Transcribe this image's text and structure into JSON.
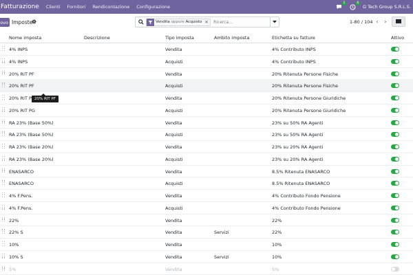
{
  "nav": {
    "brand": "Fatturazione",
    "menus": [
      "Clienti",
      "Fornitori",
      "Rendicontazione",
      "Configurazione"
    ],
    "chat_badge": "1",
    "activity_badge": "6",
    "company": "G Tech Group S.R.L.S."
  },
  "control": {
    "new_label": "ovo",
    "breadcrumb": "Imposte",
    "search": {
      "facet_a": "Vendita",
      "facet_or": "oppure",
      "facet_b": "Acquisto",
      "placeholder": "Ricerca..."
    },
    "pager": "1-80 / 104"
  },
  "columns": {
    "name": "Nome imposta",
    "description": "Descrizione",
    "type": "Tipo imposta",
    "scope": "Ambito imposta",
    "label": "Etichetta su fatture",
    "active": "Attivo"
  },
  "rows": [
    {
      "name": "4% INPS",
      "description": "",
      "type": "Vendita",
      "scope": "",
      "label": "4% Contributo INPS",
      "active": true
    },
    {
      "name": "4% INPS",
      "description": "",
      "type": "Acquisti",
      "scope": "",
      "label": "4% Contributo INPS",
      "active": true
    },
    {
      "name": "20% RIT PF",
      "description": "",
      "type": "Vendita",
      "scope": "",
      "label": "20% Ritenuta Persone Fisiche",
      "active": true
    },
    {
      "name": "20% RIT PF",
      "description": "",
      "type": "Acquisti",
      "scope": "",
      "label": "20% Ritenuta Persone Fisiche",
      "active": true
    },
    {
      "name": "20% RIT PG",
      "description": "",
      "type": "Vendita",
      "scope": "",
      "label": "20% Ritenuta Persone Giuridiche",
      "active": true
    },
    {
      "name": "20% RIT PG",
      "description": "",
      "type": "Acquisti",
      "scope": "",
      "label": "20% Ritenuta Persone Giuridiche",
      "active": true
    },
    {
      "name": "RA 23% (Base 50%)",
      "description": "",
      "type": "Vendita",
      "scope": "",
      "label": "23% su 50% RA Agenti",
      "active": true
    },
    {
      "name": "RA 23% (Base 50%)",
      "description": "",
      "type": "Acquisti",
      "scope": "",
      "label": "23% su 50% RA Agenti",
      "active": true
    },
    {
      "name": "RA 23% (Base 20%)",
      "description": "",
      "type": "Vendita",
      "scope": "",
      "label": "23% su 20% RA Agenti",
      "active": true
    },
    {
      "name": "RA 23% (Base 20%)",
      "description": "",
      "type": "Acquisti",
      "scope": "",
      "label": "23% su 20% RA Agenti",
      "active": true
    },
    {
      "name": "ENASARCO",
      "description": "",
      "type": "Vendita",
      "scope": "",
      "label": "8.5% Ritenuta ENASARCO",
      "active": true
    },
    {
      "name": "ENASARCO",
      "description": "",
      "type": "Acquisti",
      "scope": "",
      "label": "8.5% Ritenuta ENASARCO",
      "active": true
    },
    {
      "name": "4% F.Pens.",
      "description": "",
      "type": "Vendita",
      "scope": "",
      "label": "4% Contributo Fondo Pensione",
      "active": true
    },
    {
      "name": "4% F.Pens.",
      "description": "",
      "type": "Acquisti",
      "scope": "",
      "label": "4% Contributo Fondo Pensione",
      "active": true
    },
    {
      "name": "22%",
      "description": "",
      "type": "Vendita",
      "scope": "",
      "label": "22%",
      "active": true
    },
    {
      "name": "22% S",
      "description": "",
      "type": "Vendita",
      "scope": "Servizi",
      "label": "22%",
      "active": true
    },
    {
      "name": "10%",
      "description": "",
      "type": "Vendita",
      "scope": "",
      "label": "10%",
      "active": true
    },
    {
      "name": "10% S",
      "description": "",
      "type": "Vendita",
      "scope": "Servizi",
      "label": "10%",
      "active": true
    },
    {
      "name": "5%",
      "description": "",
      "type": "Vendita",
      "scope": "",
      "label": "5%",
      "active": false
    }
  ],
  "tooltip": "20% RIT PF",
  "colors": {
    "brand": "#71639e",
    "toggle_on": "#28a745",
    "badge": "#28a745"
  }
}
